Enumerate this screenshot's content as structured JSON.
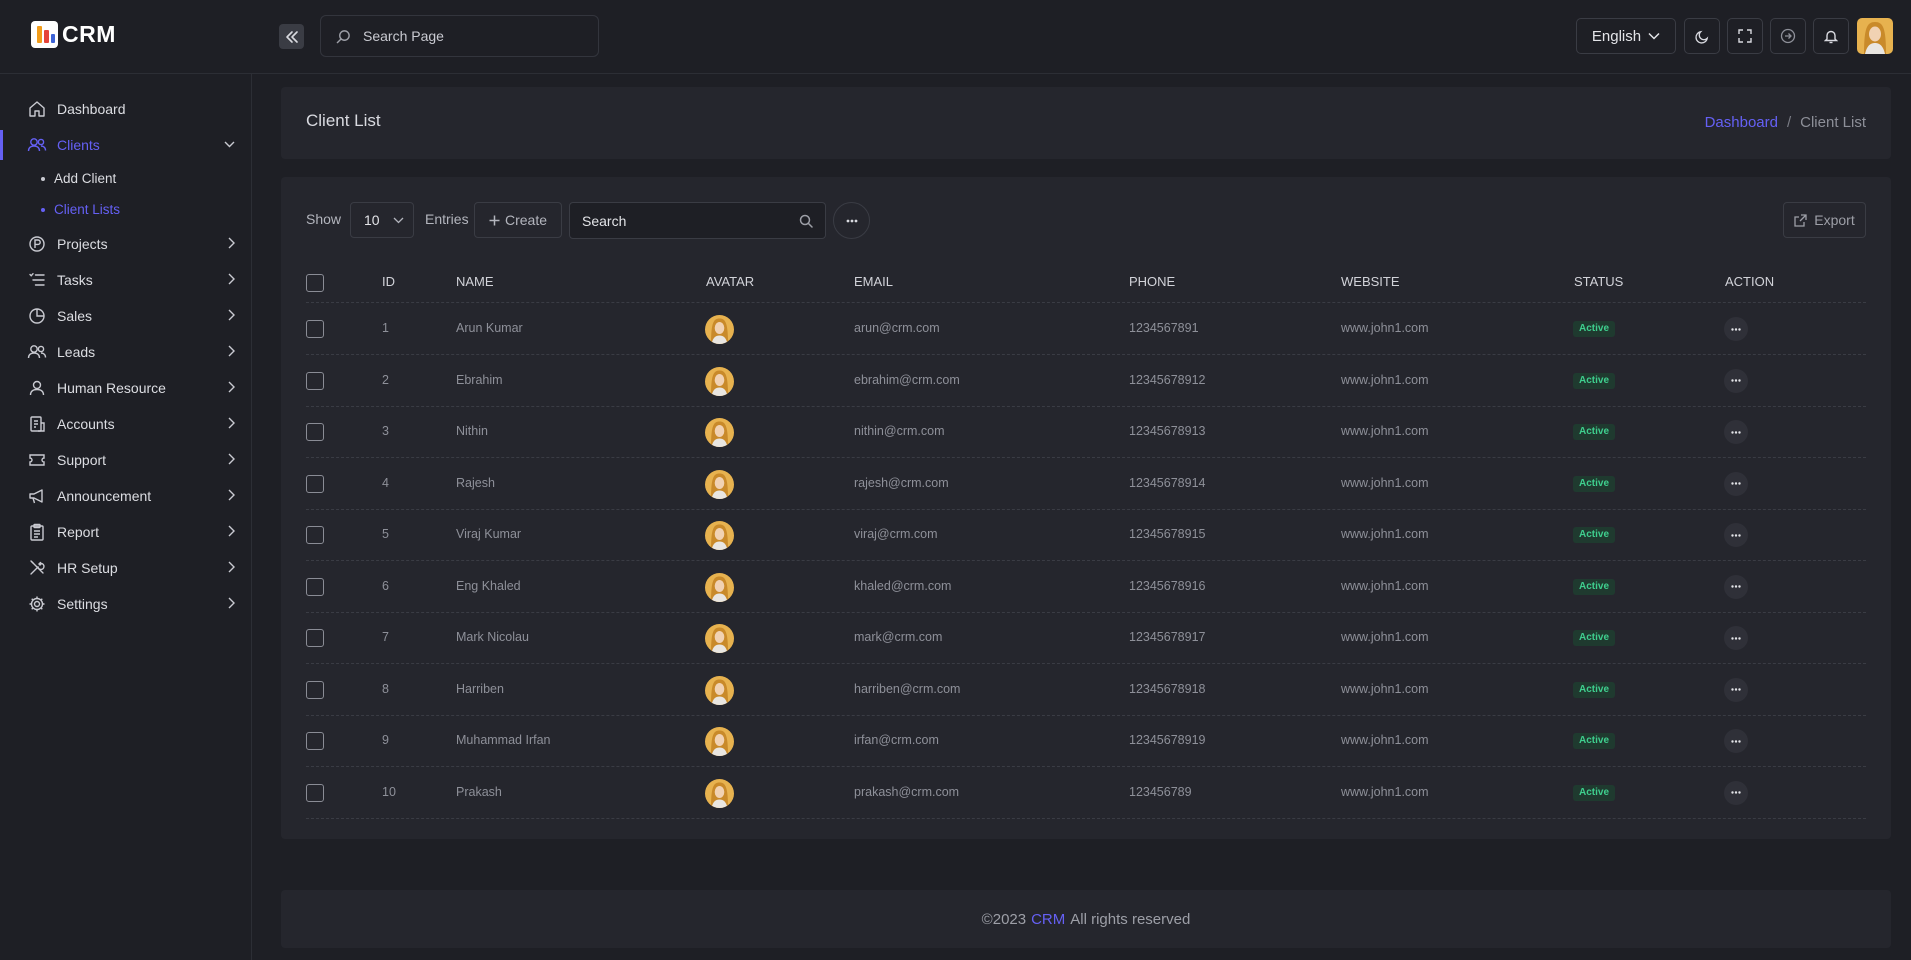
{
  "app": {
    "logo_text": "CRM"
  },
  "header": {
    "search_placeholder": "Search Page",
    "language": "English"
  },
  "sidebar": {
    "items": [
      {
        "label": "Dashboard",
        "icon": "home-icon"
      },
      {
        "label": "Clients",
        "icon": "users-icon",
        "active": true,
        "expanded": true
      },
      {
        "label": "Projects",
        "icon": "project-icon"
      },
      {
        "label": "Tasks",
        "icon": "tasks-icon"
      },
      {
        "label": "Sales",
        "icon": "pie-icon"
      },
      {
        "label": "Leads",
        "icon": "users-icon"
      },
      {
        "label": "Human Resource",
        "icon": "user-icon"
      },
      {
        "label": "Accounts",
        "icon": "accounts-icon"
      },
      {
        "label": "Support",
        "icon": "ticket-icon"
      },
      {
        "label": "Announcement",
        "icon": "megaphone-icon"
      },
      {
        "label": "Report",
        "icon": "clipboard-icon"
      },
      {
        "label": "HR Setup",
        "icon": "tools-icon"
      },
      {
        "label": "Settings",
        "icon": "gear-icon"
      }
    ],
    "subitems": [
      {
        "label": "Add Client"
      },
      {
        "label": "Client Lists",
        "active": true
      }
    ]
  },
  "page": {
    "title": "Client List",
    "breadcrumb": {
      "home": "Dashboard",
      "separator": "/",
      "current": "Client List"
    }
  },
  "toolbar": {
    "show_label": "Show",
    "entries_value": "10",
    "entries_label": "Entries",
    "create_label": "Create",
    "search_placeholder": "Search",
    "export_label": "Export"
  },
  "table": {
    "columns": [
      "ID",
      "NAME",
      "AVATAR",
      "EMAIL",
      "PHONE",
      "WEBSITE",
      "STATUS",
      "ACTION"
    ],
    "rows": [
      {
        "id": "1",
        "name": "Arun Kumar",
        "email": "arun@crm.com",
        "phone": "1234567891",
        "website": "www.john1.com",
        "status": "Active"
      },
      {
        "id": "2",
        "name": "Ebrahim",
        "email": "ebrahim@crm.com",
        "phone": "12345678912",
        "website": "www.john1.com",
        "status": "Active"
      },
      {
        "id": "3",
        "name": "Nithin",
        "email": "nithin@crm.com",
        "phone": "12345678913",
        "website": "www.john1.com",
        "status": "Active"
      },
      {
        "id": "4",
        "name": "Rajesh",
        "email": "rajesh@crm.com",
        "phone": "12345678914",
        "website": "www.john1.com",
        "status": "Active"
      },
      {
        "id": "5",
        "name": "Viraj Kumar",
        "email": "viraj@crm.com",
        "phone": "12345678915",
        "website": "www.john1.com",
        "status": "Active"
      },
      {
        "id": "6",
        "name": "Eng Khaled",
        "email": "khaled@crm.com",
        "phone": "12345678916",
        "website": "www.john1.com",
        "status": "Active"
      },
      {
        "id": "7",
        "name": "Mark Nicolau",
        "email": "mark@crm.com",
        "phone": "12345678917",
        "website": "www.john1.com",
        "status": "Active"
      },
      {
        "id": "8",
        "name": "Harriben",
        "email": "harriben@crm.com",
        "phone": "12345678918",
        "website": "www.john1.com",
        "status": "Active"
      },
      {
        "id": "9",
        "name": "Muhammad Irfan",
        "email": "irfan@crm.com",
        "phone": "12345678919",
        "website": "www.john1.com",
        "status": "Active"
      },
      {
        "id": "10",
        "name": "Prakash",
        "email": "prakash@crm.com",
        "phone": "123456789",
        "website": "www.john1.com",
        "status": "Active"
      }
    ]
  },
  "footer": {
    "prefix": "©2023",
    "brand": "CRM",
    "suffix": "All rights reserved"
  },
  "colors": {
    "accent": "#6560f4",
    "background": "#1e1f25",
    "card": "#25262d",
    "status_active": "#3fcf8e"
  }
}
